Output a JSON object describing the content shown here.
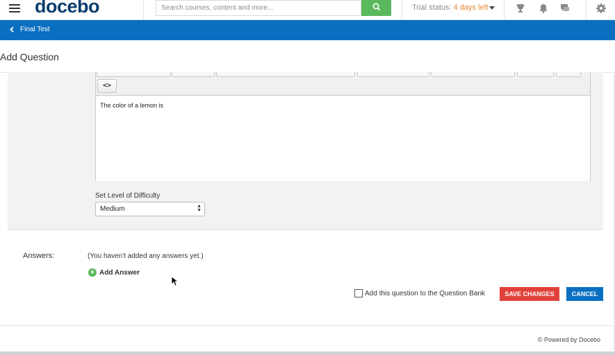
{
  "header": {
    "logo_text": "docebo",
    "logo_mark": "®",
    "search_placeholder": "Search courses, content and more...",
    "trial_prefix": "Trial status:",
    "trial_days": "4 days left",
    "icons": [
      "menu-icon",
      "search-icon",
      "chevron-down-icon",
      "trophy-icon",
      "bell-icon",
      "chat-icon",
      "gear-icon"
    ]
  },
  "breadcrumb": {
    "back_label": "Final Test"
  },
  "page": {
    "title": "Add Question"
  },
  "editor": {
    "code_button": "<>",
    "content": "The color of a lemon is"
  },
  "difficulty": {
    "label": "Set Level of Difficulty",
    "selected": "Medium"
  },
  "answers": {
    "label": "Answers:",
    "empty_message": "(You haven't added any answers yet.)",
    "add_label": "Add Answer"
  },
  "actions": {
    "question_bank_label": "Add this question to the Question Bank",
    "question_bank_checked": false,
    "save_label": "SAVE CHANGES",
    "cancel_label": "CANCEL"
  },
  "footer": {
    "text": "© Powered by Docebo"
  },
  "colors": {
    "brand_blue": "#0b6fc1",
    "logo_navy": "#0b3d6e",
    "search_green": "#5cb85c",
    "save_red": "#e0413a",
    "trial_orange": "#e58a2e"
  }
}
